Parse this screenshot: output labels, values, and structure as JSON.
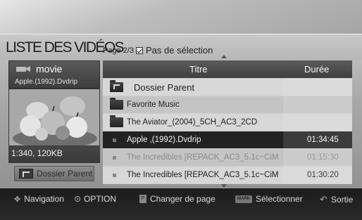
{
  "header": {
    "title": "LISTE DES VIDÉOS",
    "page_indicator": "Page 2/3",
    "selection_status": "Pas de sélection"
  },
  "preview": {
    "folder_name": "movie",
    "file_name": "Apple.(1992).Dvdrip",
    "info": "1:340, 120KB",
    "parent_button": "Dossier Parent"
  },
  "list": {
    "columns": {
      "title": "Titre",
      "duration": "Durée"
    },
    "rows": [
      {
        "type": "parent",
        "title": "Dossier Parent",
        "duration": ""
      },
      {
        "type": "folder",
        "title": "Favorite Music",
        "duration": ""
      },
      {
        "type": "folder",
        "title": "The Aviator_(2004)_5CH_AC3_2CD",
        "duration": ""
      },
      {
        "type": "file",
        "title": "Apple ,(1992).Dvdrip",
        "duration": "01:34:45",
        "selected": true
      },
      {
        "type": "file",
        "title": "The Incredibles [REPACK_AC3_5.1c~CiM",
        "duration": "01:15:30",
        "dim": true
      },
      {
        "type": "file",
        "title": "The Incredibles [REPACK_AC3_5.1c~CiM",
        "duration": "01:30:20"
      }
    ]
  },
  "footer": {
    "navigation": "Navigation",
    "option": "OPTION",
    "page_change": "Changer de page",
    "mark_key": "MARK",
    "select": "Sélectionner",
    "exit": "Sortie"
  },
  "colors": {
    "selected_row": "#222222",
    "header_dark": "#3f3f3f",
    "footer_bg": "#1c1c1c"
  },
  "icons": [
    "movie-icon",
    "folder-icon",
    "parent-folder-icon",
    "checkbox-icon",
    "navigation-icon",
    "option-icon",
    "page-icon",
    "mark-icon",
    "return-icon",
    "scroll-up-icon",
    "scroll-down-icon"
  ]
}
